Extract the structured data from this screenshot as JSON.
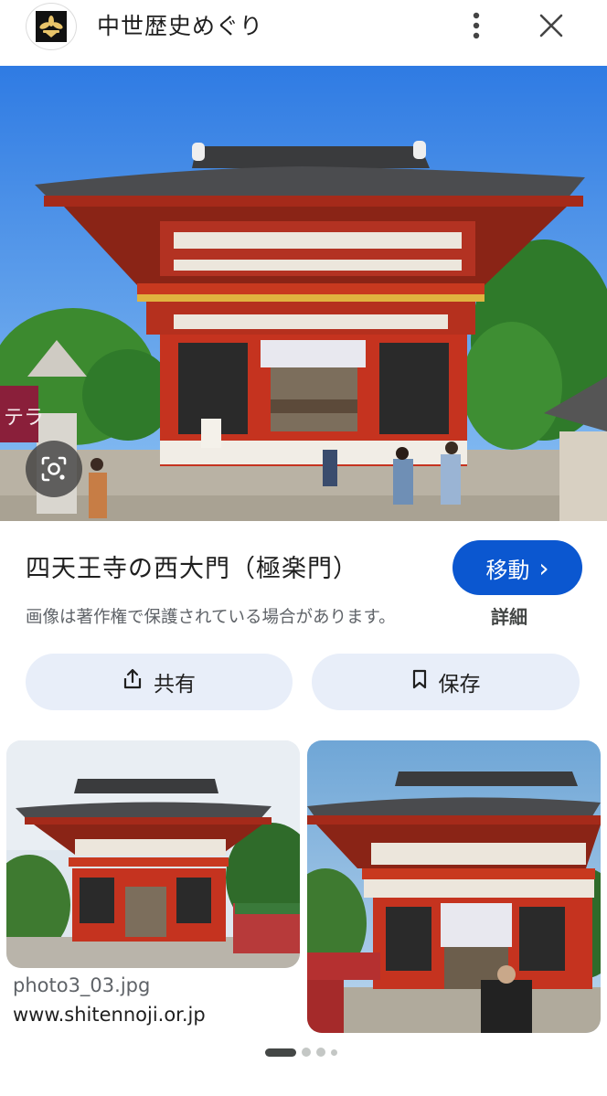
{
  "header": {
    "site_name": "中世歴史めぐり",
    "logo_icon": "crest-logo-icon",
    "more_icon": "more-vert-icon",
    "close_icon": "close-icon"
  },
  "main_image": {
    "alt": "四天王寺の西大門（極楽門）",
    "banner_text": "テラ",
    "lens_icon": "google-lens-icon"
  },
  "info": {
    "title": "四天王寺の西大門（極楽門）",
    "visit_label": "移動",
    "visit_chevron": "›",
    "copyright_notice": "画像は著作権で保護されている場合があります。",
    "details_label": "詳細"
  },
  "actions": {
    "share_label": "共有",
    "save_label": "保存"
  },
  "related": [
    {
      "filename": "photo3_03.jpg",
      "domain": "www.shitennoji.or.jp"
    },
    {
      "filename": "",
      "domain": ""
    }
  ],
  "colors": {
    "accent": "#0b57d0",
    "action_bg": "#e8eef9",
    "secondary_text": "#5f6368"
  }
}
